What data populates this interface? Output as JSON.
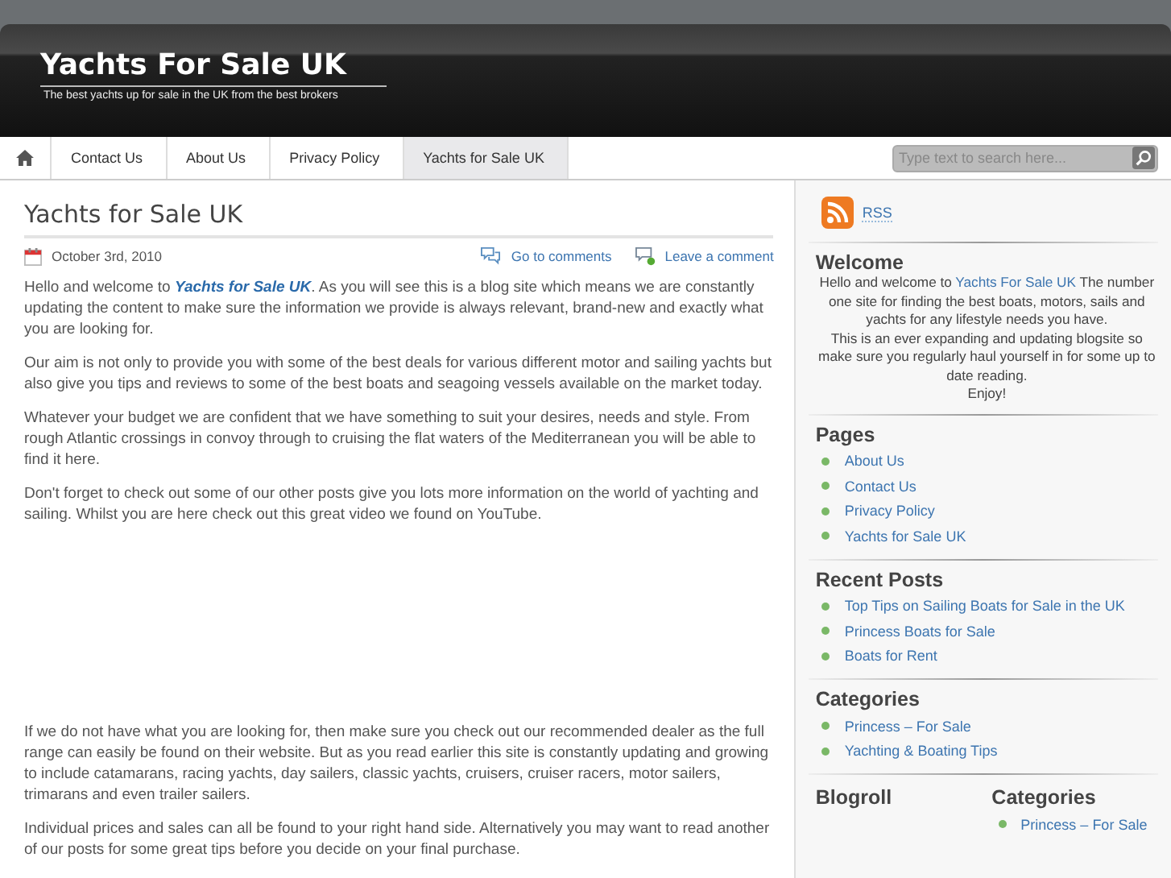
{
  "site": {
    "title": "Yachts For Sale UK",
    "tagline": "The best yachts up for sale in the UK from the best brokers"
  },
  "nav": {
    "items": [
      {
        "label": "Contact Us",
        "selected": false
      },
      {
        "label": "About Us",
        "selected": false
      },
      {
        "label": "Privacy Policy",
        "selected": false
      },
      {
        "label": "Yachts for Sale UK",
        "selected": true
      }
    ],
    "search": {
      "placeholder": "Type text to search here..."
    }
  },
  "post": {
    "title": "Yachts for Sale UK",
    "date": "October 3rd, 2010",
    "links": [
      "Go to comments",
      "Leave a comment"
    ],
    "paragraphs": [
      {
        "segments": [
          {
            "kind": "text",
            "text": "Hello and welcome to "
          },
          {
            "kind": "link",
            "text": "Yachts for Sale UK"
          },
          {
            "kind": "text",
            "text": ". As you will see this is a blog site which means we are constantly updating the content to make sure the information we provide is always relevant, brand-new and exactly what you are looking for."
          }
        ]
      },
      {
        "segments": [
          {
            "kind": "text",
            "text": "Our aim is not only to provide you with some of the best deals for various different motor and sailing yachts but also give you tips and reviews to some of the best boats and seagoing vessels available on the market today."
          }
        ]
      },
      {
        "segments": [
          {
            "kind": "text",
            "text": "Whatever your budget we are confident that we have something to suit your desires, needs and style. From rough Atlantic crossings in convoy through to cruising the flat waters of the Mediterranean you will be able to find it here."
          }
        ]
      },
      {
        "segments": [
          {
            "kind": "text",
            "text": "Don't forget to check out some of our other posts give you lots more information on the world of yachting and sailing. Whilst you are here check out this great video we found on YouTube."
          }
        ]
      },
      {
        "segments": [
          {
            "kind": "text",
            "text": "If we do not have what you are looking for, then make sure you check out our recommended dealer as the full range can easily be found on their website. But as you read earlier this site is constantly updating and growing to include catamarans, racing yachts, day sailers, classic yachts, cruisers, cruiser racers, motor sailers, trimarans and even trailer sailers."
          }
        ]
      },
      {
        "segments": [
          {
            "kind": "text",
            "text": "Individual prices and sales can all be found to your right hand side. Alternatively you may want to read another of our posts for some great tips before you decide on your final purchase."
          }
        ]
      }
    ]
  },
  "sidebar": {
    "rss": "RSS",
    "welcome": {
      "title": "Welcome",
      "paragraphs": [
        {
          "segments": [
            {
              "kind": "text",
              "text": "Hello and welcome to "
            },
            {
              "kind": "link",
              "text": "Yachts For Sale UK"
            },
            {
              "kind": "text",
              "text": " The number one site for finding the best boats, motors, sails and yachts for any lifestyle needs you have."
            }
          ]
        },
        {
          "segments": [
            {
              "kind": "text",
              "text": "This is an ever expanding and updating blogsite so make sure you regularly haul yourself in for some up to date reading."
            }
          ]
        },
        {
          "segments": [
            {
              "kind": "text",
              "text": "Enjoy!"
            }
          ]
        }
      ]
    },
    "widgets": [
      {
        "title": "Pages",
        "items": [
          "About Us",
          "Contact Us",
          "Privacy Policy",
          "Yachts for Sale UK"
        ]
      },
      {
        "title": "Recent Posts",
        "items": [
          "Top Tips on Sailing Boats for Sale in the UK",
          "Princess Boats for Sale",
          "Boats for Rent"
        ]
      },
      {
        "title": "Categories",
        "items": [
          "Princess – For Sale",
          "Yachting & Boating Tips"
        ]
      }
    ],
    "columns": [
      {
        "title": "Blogroll"
      },
      {
        "title": "Categories",
        "items": [
          "Princess – For Sale"
        ]
      }
    ]
  }
}
